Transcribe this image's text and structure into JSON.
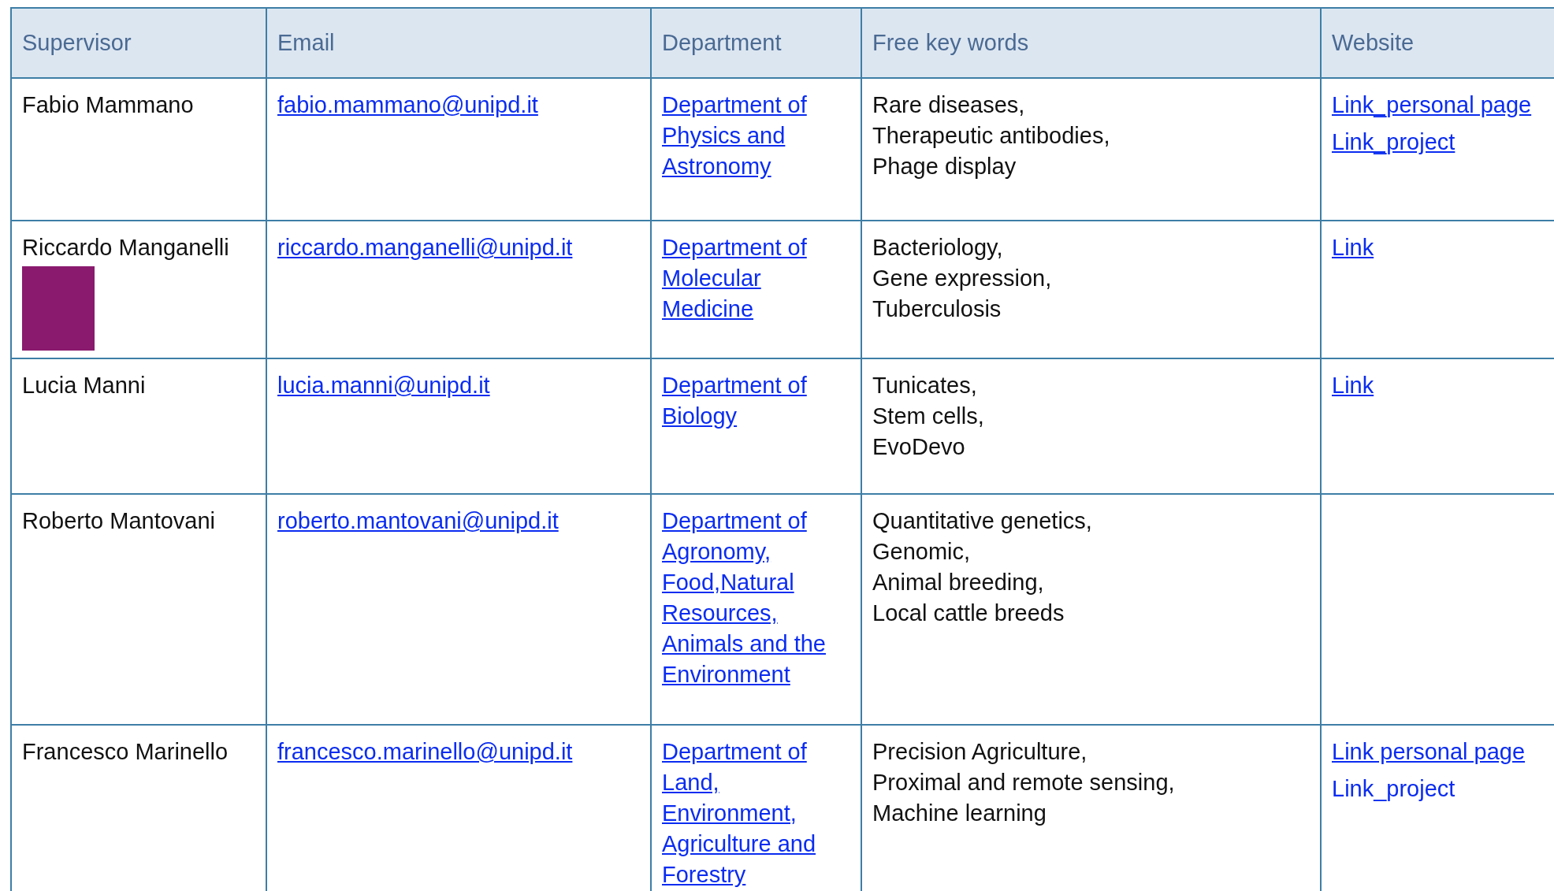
{
  "table": {
    "columns": [
      "Supervisor",
      "Email",
      "Department",
      "Free key words",
      "Website"
    ],
    "rows": [
      {
        "supervisor": "Fabio Mammano",
        "photo": false,
        "email": "fabio.mammano@unipd.it",
        "department": "Department of Physics and Astronomy",
        "keywords": [
          "Rare diseases,",
          "Therapeutic antibodies,",
          "Phage display"
        ],
        "websites": [
          {
            "text": "Link_personal page",
            "underlined": true
          },
          {
            "text": "Link_project",
            "underlined": true
          }
        ]
      },
      {
        "supervisor": "Riccardo Manganelli",
        "photo": true,
        "email": "riccardo.manganelli@unipd.it",
        "department": "Department of Molecular Medicine",
        "keywords": [
          "Bacteriology,",
          "Gene expression,",
          "Tuberculosis"
        ],
        "websites": [
          {
            "text": "Link",
            "underlined": true
          }
        ]
      },
      {
        "supervisor": "Lucia Manni",
        "photo": false,
        "email": "lucia.manni@unipd.it",
        "department": "Department of Biology",
        "keywords": [
          "Tunicates,",
          "Stem cells,",
          "EvoDevo"
        ],
        "websites": [
          {
            "text": "Link",
            "underlined": true
          }
        ]
      },
      {
        "supervisor": "Roberto Mantovani",
        "photo": false,
        "email": "roberto.mantovani@unipd.it",
        "department": "Department of Agronomy, Food,Natural Resources, Animals and the Environment",
        "keywords": [
          "Quantitative genetics,",
          "Genomic,",
          "Animal breeding,",
          "Local cattle breeds"
        ],
        "websites": []
      },
      {
        "supervisor": "Francesco Marinello",
        "photo": false,
        "email": "francesco.marinello@unipd.it",
        "department": "Department of Land, Environment, Agriculture and Forestry",
        "keywords": [
          "Precision Agriculture,",
          "Proximal and remote sensing,",
          "Machine learning"
        ],
        "websites": [
          {
            "text": "Link personal page",
            "underlined": true
          },
          {
            "text": "Link_project",
            "underlined": false
          }
        ]
      }
    ]
  }
}
